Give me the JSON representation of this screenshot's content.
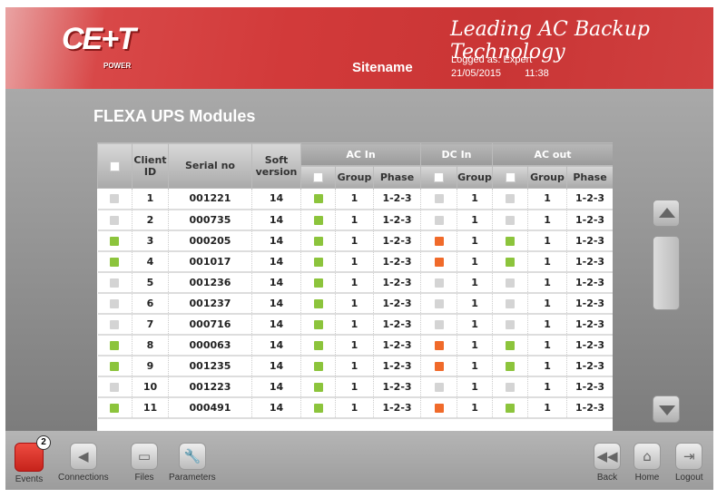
{
  "header": {
    "logo": "CE+T",
    "logo_sub": "POWER",
    "tagline": "Leading AC Backup Technology",
    "sitename": "Sitename",
    "logged": "Logged as: Expert",
    "date": "21/05/2015",
    "time": "11:38"
  },
  "page_title": "FLEXA UPS Modules",
  "table": {
    "headers": {
      "client_id": "Client ID",
      "serial": "Serial no",
      "soft": "Soft version",
      "ac_in": "AC In",
      "dc_in": "DC In",
      "ac_out": "AC out",
      "group": "Group",
      "phase": "Phase"
    },
    "colors": {
      "green": "#8cc43c",
      "orange": "#f06a2a",
      "grey": "#d4d4d4"
    },
    "rows": [
      {
        "id": "1",
        "serial": "001221",
        "soft": "14",
        "sel": "grey",
        "ac_in": "green",
        "ac_in_group": "1",
        "ac_in_phase": "1-2-3",
        "dc_in": "grey",
        "dc_in_group": "1",
        "ac_out": "grey",
        "ac_out_group": "1",
        "ac_out_phase": "1-2-3"
      },
      {
        "id": "2",
        "serial": "000735",
        "soft": "14",
        "sel": "grey",
        "ac_in": "green",
        "ac_in_group": "1",
        "ac_in_phase": "1-2-3",
        "dc_in": "grey",
        "dc_in_group": "1",
        "ac_out": "grey",
        "ac_out_group": "1",
        "ac_out_phase": "1-2-3"
      },
      {
        "id": "3",
        "serial": "000205",
        "soft": "14",
        "sel": "green",
        "ac_in": "green",
        "ac_in_group": "1",
        "ac_in_phase": "1-2-3",
        "dc_in": "orange",
        "dc_in_group": "1",
        "ac_out": "green",
        "ac_out_group": "1",
        "ac_out_phase": "1-2-3"
      },
      {
        "id": "4",
        "serial": "001017",
        "soft": "14",
        "sel": "green",
        "ac_in": "green",
        "ac_in_group": "1",
        "ac_in_phase": "1-2-3",
        "dc_in": "orange",
        "dc_in_group": "1",
        "ac_out": "green",
        "ac_out_group": "1",
        "ac_out_phase": "1-2-3"
      },
      {
        "id": "5",
        "serial": "001236",
        "soft": "14",
        "sel": "grey",
        "ac_in": "green",
        "ac_in_group": "1",
        "ac_in_phase": "1-2-3",
        "dc_in": "grey",
        "dc_in_group": "1",
        "ac_out": "grey",
        "ac_out_group": "1",
        "ac_out_phase": "1-2-3"
      },
      {
        "id": "6",
        "serial": "001237",
        "soft": "14",
        "sel": "grey",
        "ac_in": "green",
        "ac_in_group": "1",
        "ac_in_phase": "1-2-3",
        "dc_in": "grey",
        "dc_in_group": "1",
        "ac_out": "grey",
        "ac_out_group": "1",
        "ac_out_phase": "1-2-3"
      },
      {
        "id": "7",
        "serial": "000716",
        "soft": "14",
        "sel": "grey",
        "ac_in": "green",
        "ac_in_group": "1",
        "ac_in_phase": "1-2-3",
        "dc_in": "grey",
        "dc_in_group": "1",
        "ac_out": "grey",
        "ac_out_group": "1",
        "ac_out_phase": "1-2-3"
      },
      {
        "id": "8",
        "serial": "000063",
        "soft": "14",
        "sel": "green",
        "ac_in": "green",
        "ac_in_group": "1",
        "ac_in_phase": "1-2-3",
        "dc_in": "orange",
        "dc_in_group": "1",
        "ac_out": "green",
        "ac_out_group": "1",
        "ac_out_phase": "1-2-3"
      },
      {
        "id": "9",
        "serial": "001235",
        "soft": "14",
        "sel": "green",
        "ac_in": "green",
        "ac_in_group": "1",
        "ac_in_phase": "1-2-3",
        "dc_in": "orange",
        "dc_in_group": "1",
        "ac_out": "green",
        "ac_out_group": "1",
        "ac_out_phase": "1-2-3"
      },
      {
        "id": "10",
        "serial": "001223",
        "soft": "14",
        "sel": "grey",
        "ac_in": "green",
        "ac_in_group": "1",
        "ac_in_phase": "1-2-3",
        "dc_in": "grey",
        "dc_in_group": "1",
        "ac_out": "grey",
        "ac_out_group": "1",
        "ac_out_phase": "1-2-3"
      },
      {
        "id": "11",
        "serial": "000491",
        "soft": "14",
        "sel": "green",
        "ac_in": "green",
        "ac_in_group": "1",
        "ac_in_phase": "1-2-3",
        "dc_in": "orange",
        "dc_in_group": "1",
        "ac_out": "green",
        "ac_out_group": "1",
        "ac_out_phase": "1-2-3"
      }
    ]
  },
  "footer": {
    "events": "Events",
    "events_badge": "2",
    "connections": "Connections",
    "files": "Files",
    "parameters": "Parameters",
    "back": "Back",
    "home": "Home",
    "logout": "Logout"
  }
}
